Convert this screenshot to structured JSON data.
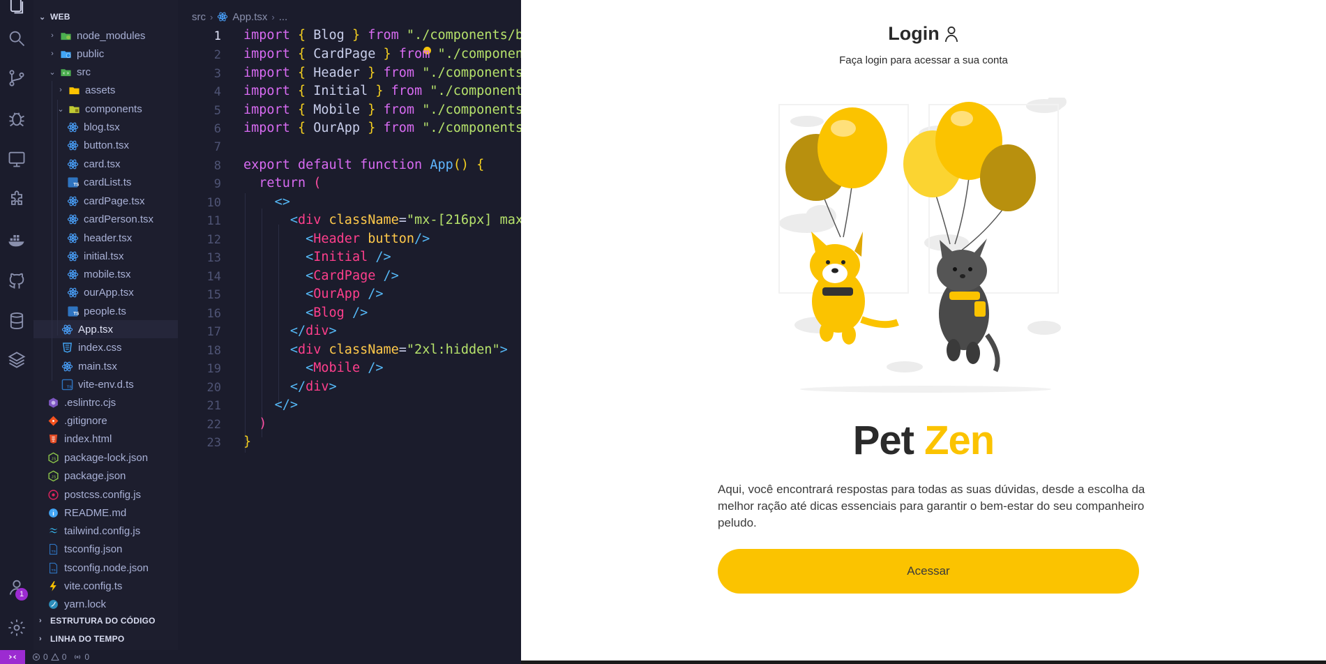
{
  "explorer": {
    "root_label": "WEB",
    "items": [
      {
        "label": "node_modules",
        "kind": "folder",
        "icon": "node-folder-icon"
      },
      {
        "label": "public",
        "kind": "folder",
        "icon": "public-folder-icon"
      },
      {
        "label": "src",
        "kind": "folder",
        "icon": "src-folder-icon"
      },
      {
        "label": "assets",
        "kind": "folder",
        "icon": "assets-folder-icon"
      },
      {
        "label": "components",
        "kind": "folder",
        "icon": "components-folder-icon"
      },
      {
        "label": "blog.tsx",
        "kind": "file",
        "icon": "react-icon"
      },
      {
        "label": "button.tsx",
        "kind": "file",
        "icon": "react-icon"
      },
      {
        "label": "card.tsx",
        "kind": "file",
        "icon": "react-icon"
      },
      {
        "label": "cardList.ts",
        "kind": "file",
        "icon": "typescript-icon"
      },
      {
        "label": "cardPage.tsx",
        "kind": "file",
        "icon": "react-icon"
      },
      {
        "label": "cardPerson.tsx",
        "kind": "file",
        "icon": "react-icon"
      },
      {
        "label": "header.tsx",
        "kind": "file",
        "icon": "react-icon"
      },
      {
        "label": "initial.tsx",
        "kind": "file",
        "icon": "react-icon"
      },
      {
        "label": "mobile.tsx",
        "kind": "file",
        "icon": "react-icon"
      },
      {
        "label": "ourApp.tsx",
        "kind": "file",
        "icon": "react-icon"
      },
      {
        "label": "people.ts",
        "kind": "file",
        "icon": "typescript-icon"
      },
      {
        "label": "App.tsx",
        "kind": "file",
        "icon": "react-icon"
      },
      {
        "label": "index.css",
        "kind": "file",
        "icon": "css-icon"
      },
      {
        "label": "main.tsx",
        "kind": "file",
        "icon": "react-icon"
      },
      {
        "label": "vite-env.d.ts",
        "kind": "file",
        "icon": "typescript-def-icon"
      },
      {
        "label": ".eslintrc.cjs",
        "kind": "file",
        "icon": "eslint-icon"
      },
      {
        "label": ".gitignore",
        "kind": "file",
        "icon": "git-icon"
      },
      {
        "label": "index.html",
        "kind": "file",
        "icon": "html-icon"
      },
      {
        "label": "package-lock.json",
        "kind": "file",
        "icon": "npm-json-icon"
      },
      {
        "label": "package.json",
        "kind": "file",
        "icon": "npm-json-icon"
      },
      {
        "label": "postcss.config.js",
        "kind": "file",
        "icon": "postcss-icon"
      },
      {
        "label": "README.md",
        "kind": "file",
        "icon": "info-icon"
      },
      {
        "label": "tailwind.config.js",
        "kind": "file",
        "icon": "tailwind-icon"
      },
      {
        "label": "tsconfig.json",
        "kind": "file",
        "icon": "tsconfig-icon"
      },
      {
        "label": "tsconfig.node.json",
        "kind": "file",
        "icon": "tsconfig-icon"
      },
      {
        "label": "vite.config.ts",
        "kind": "file",
        "icon": "vite-icon"
      },
      {
        "label": "yarn.lock",
        "kind": "file",
        "icon": "yarn-icon"
      }
    ],
    "selected": "App.tsx",
    "sections": [
      "ESTRUTURA DO CÓDIGO",
      "LINHA DO TEMPO"
    ]
  },
  "editor": {
    "breadcrumb": [
      "src",
      "App.tsx",
      "..."
    ],
    "active_line": "1",
    "line_numbers": [
      "1",
      "2",
      "3",
      "4",
      "5",
      "6",
      "7",
      "8",
      "9",
      "10",
      "11",
      "12",
      "13",
      "14",
      "15",
      "16",
      "17",
      "18",
      "19",
      "20",
      "21",
      "22",
      "23"
    ]
  },
  "activity_bar": {
    "accounts_badge": "1"
  },
  "statusbar": {
    "errors": "0",
    "warnings": "0",
    "ports": "0"
  },
  "preview": {
    "title": "Login",
    "subtitle": "Faça login para acessar a sua conta",
    "brand_part1": "Pet",
    "brand_part2": "Zen",
    "description": "Aqui, você encontrará respostas para todas as suas dúvidas, desde a escolha da melhor ração até dicas essenciais para garantir o bem-estar do seu companheiro peludo.",
    "cta_label": "Acessar",
    "accent_color": "#fbc300"
  },
  "colors": {
    "editor_bg": "#1b1c2c",
    "remote_accent": "#9c2bd1",
    "brand_yellow": "#fbc300"
  }
}
